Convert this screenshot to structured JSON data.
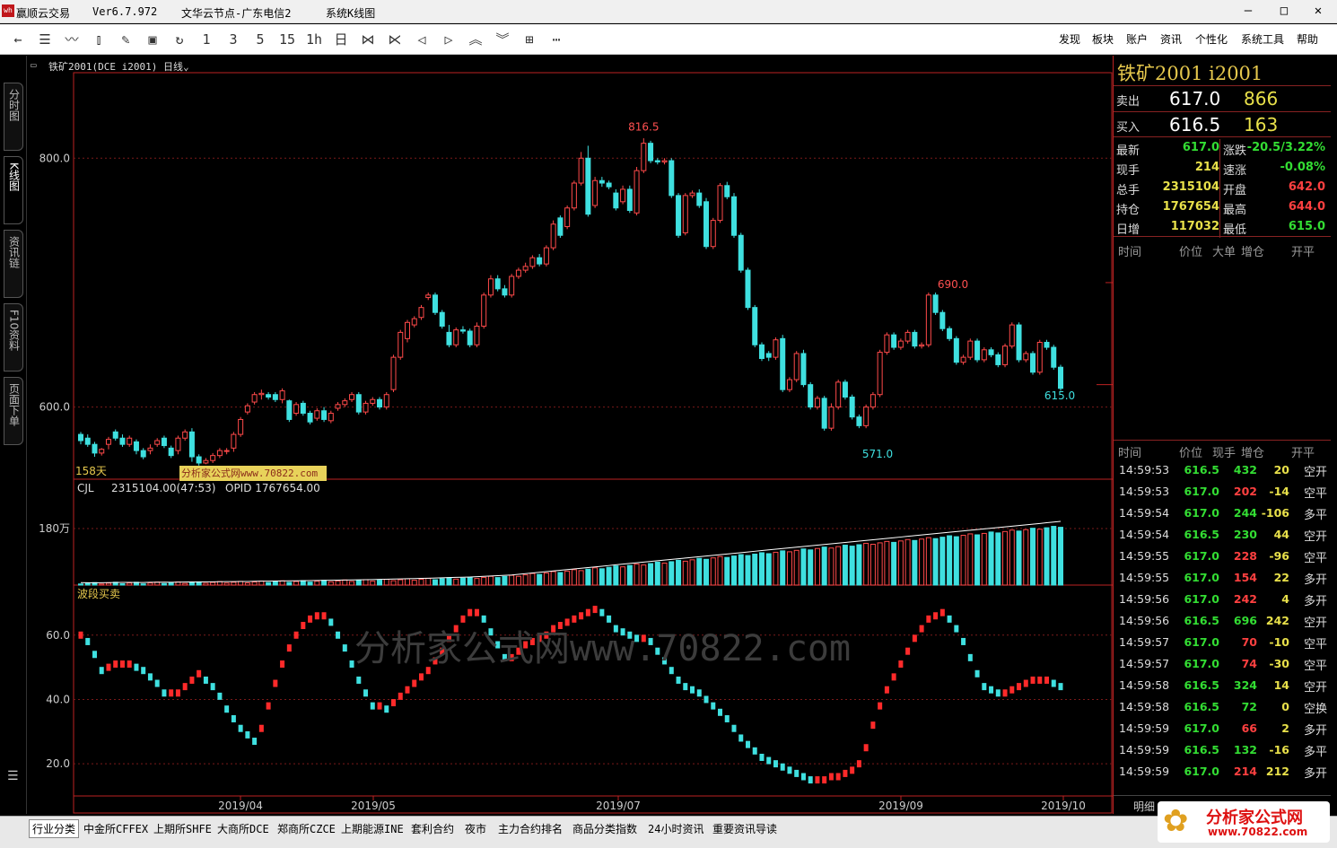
{
  "window": {
    "title": "赢顺云交易",
    "version": "Ver6.7.972",
    "node": "文华云节点-广东电信2",
    "chart_name": "系统K线图"
  },
  "toolbar": {
    "icons": [
      "back-icon",
      "list-icon",
      "line-chart-icon",
      "candle-icon",
      "draw-icon",
      "save-icon",
      "refresh-icon"
    ],
    "periods": [
      "1",
      "3",
      "5",
      "15",
      "1h",
      "日"
    ],
    "menu": [
      "发现",
      "板块",
      "账户",
      "资讯",
      "个性化",
      "系统工具",
      "帮助"
    ]
  },
  "side_tabs": [
    "分时图",
    "K线图",
    "资讯链",
    "F10资料",
    "页面下单"
  ],
  "chart_header": {
    "symbol": "铁矿2001(DCE i2001)",
    "period": "日线"
  },
  "main_chart": {
    "y_labels": [
      "800.0",
      "600.0"
    ],
    "days_label": "158天",
    "annotations": [
      "816.5",
      "690.0",
      "571.0",
      "615.0"
    ]
  },
  "volume_panel": {
    "name": "CJL",
    "cjl": "2315104.00(47:53)",
    "opid": "OPID 1767654.00",
    "y_label": "180万"
  },
  "wave_panel": {
    "name": "波段买卖",
    "y_labels": [
      "60.0",
      "40.0",
      "20.0"
    ]
  },
  "x_labels": [
    "2019/04",
    "2019/05",
    "2019/07",
    "2019/09",
    "2019/10"
  ],
  "watermark": "分析家公式网www.70822.com",
  "watermark_label": "分析家公式网www.70822.com",
  "quote": {
    "title": "铁矿2001  i2001",
    "sell": {
      "label": "卖出",
      "price": "617.0",
      "vol": "866"
    },
    "buy": {
      "label": "买入",
      "price": "616.5",
      "vol": "163"
    },
    "stats": [
      {
        "l1": "最新",
        "v1": "617.0",
        "l2": "涨跌",
        "v2": "-20.5/3.22%"
      },
      {
        "l1": "现手",
        "v1": "214",
        "l2": "速涨",
        "v2": "-0.08%"
      },
      {
        "l1": "总手",
        "v1": "2315104",
        "l2": "开盘",
        "v2": "642.0"
      },
      {
        "l1": "持仓",
        "v1": "1767654",
        "l2": "最高",
        "v2": "644.0"
      },
      {
        "l1": "日增",
        "v1": "117032",
        "l2": "最低",
        "v2": "615.0"
      }
    ],
    "header1": [
      "时间",
      "价位",
      "大单",
      "增仓",
      "开平"
    ],
    "header2": [
      "时间",
      "价位",
      "现手",
      "增仓",
      "开平"
    ],
    "ticks": [
      [
        "14:59:53",
        "616.5",
        "432",
        "20",
        "空开"
      ],
      [
        "14:59:53",
        "617.0",
        "202",
        "-14",
        "空平"
      ],
      [
        "14:59:54",
        "617.0",
        "244",
        "-106",
        "多平"
      ],
      [
        "14:59:54",
        "616.5",
        "230",
        "44",
        "空开"
      ],
      [
        "14:59:55",
        "617.0",
        "228",
        "-96",
        "空平"
      ],
      [
        "14:59:55",
        "617.0",
        "154",
        "22",
        "多开"
      ],
      [
        "14:59:56",
        "617.0",
        "242",
        "4",
        "多开"
      ],
      [
        "14:59:56",
        "616.5",
        "696",
        "242",
        "空开"
      ],
      [
        "14:59:57",
        "617.0",
        "70",
        "-10",
        "空平"
      ],
      [
        "14:59:57",
        "617.0",
        "74",
        "-30",
        "空平"
      ],
      [
        "14:59:58",
        "616.5",
        "324",
        "14",
        "空开"
      ],
      [
        "14:59:58",
        "616.5",
        "72",
        "0",
        "空换"
      ],
      [
        "14:59:59",
        "617.0",
        "66",
        "2",
        "多开"
      ],
      [
        "14:59:59",
        "616.5",
        "132",
        "-16",
        "多平"
      ],
      [
        "14:59:59",
        "617.0",
        "214",
        "212",
        "多开"
      ]
    ],
    "detail_label": "明细"
  },
  "bottom_tabs": [
    "行业分类",
    "中金所CFFEX",
    "上期所SHFE",
    "大商所DCE",
    "郑商所CZCE",
    "上期能源INE",
    "套利合约",
    "夜市",
    "主力合约排名",
    "商品分类指数",
    "24小时资讯",
    "重要资讯导读"
  ],
  "brand": {
    "name": "分析家公式网",
    "url": "www.70822.com"
  },
  "chart_data": {
    "type": "candlestick",
    "x_labels": [
      "2019/04",
      "2019/05",
      "2019/07",
      "2019/09",
      "2019/10"
    ],
    "ylim": [
      542,
      868
    ],
    "close": [
      573,
      570,
      563,
      566,
      574,
      575,
      570,
      575,
      565,
      560,
      567,
      573,
      569,
      561,
      575,
      580,
      560,
      555,
      557,
      561,
      565,
      565,
      578,
      590,
      601,
      610,
      611,
      608,
      606,
      613,
      590,
      602,
      595,
      588,
      597,
      590,
      595,
      602,
      605,
      610,
      596,
      603,
      606,
      600,
      610,
      640,
      660,
      668,
      671,
      680,
      690,
      676,
      665,
      650,
      662,
      661,
      650,
      665,
      690,
      703,
      695,
      690,
      705,
      710,
      713,
      720,
      715,
      728,
      747,
      738,
      760,
      780,
      800,
      755,
      782,
      780,
      777,
      760,
      775,
      758,
      790,
      812,
      798,
      797,
      798,
      770,
      738,
      770,
      772,
      762,
      729,
      750,
      778,
      769,
      738,
      710,
      680,
      650,
      639,
      640,
      654,
      614,
      622,
      643,
      618,
      600,
      607,
      583,
      600,
      620,
      608,
      592,
      585,
      600,
      610,
      644,
      658,
      648,
      653,
      660,
      649,
      650,
      690,
      676,
      663,
      655,
      636,
      640,
      653,
      638,
      646,
      642,
      634,
      649,
      666,
      638,
      643,
      628,
      652,
      648,
      632,
      615
    ],
    "open": [
      578,
      575,
      570,
      563,
      570,
      580,
      575,
      570,
      572,
      565,
      565,
      570,
      575,
      567,
      565,
      575,
      580,
      560,
      555,
      557,
      561,
      565,
      567,
      578,
      596,
      604,
      610,
      610,
      610,
      606,
      605,
      595,
      603,
      595,
      591,
      597,
      589,
      599,
      602,
      606,
      610,
      596,
      603,
      606,
      600,
      614,
      640,
      655,
      666,
      672,
      688,
      690,
      676,
      660,
      650,
      662,
      661,
      650,
      665,
      690,
      703,
      695,
      690,
      705,
      710,
      713,
      720,
      715,
      728,
      752,
      745,
      760,
      780,
      800,
      762,
      782,
      780,
      772,
      765,
      775,
      756,
      790,
      812,
      798,
      797,
      798,
      770,
      740,
      770,
      772,
      765,
      729,
      750,
      778,
      769,
      738,
      710,
      680,
      650,
      643,
      640,
      655,
      614,
      622,
      643,
      618,
      600,
      607,
      583,
      600,
      620,
      608,
      592,
      585,
      600,
      610,
      644,
      658,
      648,
      653,
      660,
      649,
      650,
      690,
      676,
      663,
      655,
      636,
      640,
      653,
      638,
      646,
      642,
      634,
      649,
      666,
      638,
      643,
      628,
      652,
      648,
      632
    ],
    "high": [
      580,
      578,
      572,
      567,
      576,
      582,
      578,
      577,
      574,
      567,
      570,
      575,
      577,
      569,
      577,
      582,
      583,
      562,
      559,
      563,
      567,
      567,
      580,
      592,
      603,
      612,
      614,
      612,
      612,
      615,
      606,
      604,
      605,
      597,
      599,
      600,
      597,
      604,
      607,
      612,
      612,
      605,
      608,
      608,
      612,
      642,
      662,
      670,
      673,
      682,
      692,
      692,
      678,
      666,
      664,
      665,
      663,
      668,
      692,
      706,
      706,
      698,
      707,
      712,
      716,
      722,
      723,
      730,
      750,
      754,
      762,
      782,
      805,
      810,
      785,
      785,
      782,
      775,
      778,
      778,
      793,
      816,
      814,
      800,
      800,
      800,
      772,
      772,
      774,
      775,
      768,
      752,
      780,
      781,
      772,
      740,
      712,
      682,
      652,
      645,
      656,
      658,
      624,
      645,
      646,
      620,
      609,
      609,
      603,
      622,
      622,
      610,
      594,
      602,
      612,
      646,
      660,
      660,
      655,
      662,
      662,
      652,
      692,
      692,
      678,
      665,
      657,
      642,
      655,
      655,
      648,
      648,
      644,
      651,
      668,
      668,
      645,
      645,
      654,
      654,
      650,
      634
    ],
    "low": [
      570,
      568,
      560,
      561,
      566,
      573,
      568,
      568,
      562,
      558,
      562,
      568,
      567,
      559,
      562,
      573,
      556,
      553,
      554,
      555,
      559,
      562,
      564,
      576,
      594,
      602,
      606,
      606,
      604,
      603,
      588,
      593,
      593,
      586,
      589,
      588,
      587,
      597,
      600,
      604,
      594,
      594,
      601,
      598,
      598,
      612,
      638,
      652,
      664,
      670,
      686,
      674,
      663,
      648,
      648,
      659,
      648,
      648,
      663,
      688,
      693,
      688,
      688,
      703,
      708,
      711,
      713,
      713,
      726,
      736,
      743,
      758,
      778,
      753,
      760,
      777,
      775,
      758,
      763,
      756,
      754,
      788,
      796,
      795,
      795,
      768,
      736,
      738,
      768,
      760,
      727,
      727,
      748,
      767,
      736,
      708,
      678,
      648,
      637,
      637,
      638,
      612,
      612,
      620,
      616,
      598,
      598,
      581,
      581,
      598,
      606,
      590,
      583,
      583,
      598,
      608,
      642,
      646,
      646,
      651,
      647,
      647,
      648,
      674,
      661,
      653,
      634,
      634,
      638,
      636,
      636,
      640,
      632,
      632,
      647,
      636,
      636,
      626,
      626,
      646,
      630,
      613
    ],
    "volume_max": 3200000,
    "volumes": [
      35,
      32,
      30,
      34,
      36,
      40,
      42,
      41,
      40,
      38,
      44,
      46,
      48,
      45,
      50,
      52,
      55,
      53,
      58,
      60,
      62,
      64,
      66,
      68,
      70,
      74,
      78,
      80,
      82,
      85,
      88,
      90,
      92,
      95,
      98,
      102,
      105,
      108,
      112,
      115,
      118,
      122,
      125,
      130,
      135,
      140,
      145,
      150,
      155,
      160,
      165,
      170,
      178,
      185,
      190,
      195,
      200,
      210,
      220,
      230,
      240,
      250,
      260,
      280,
      300,
      320,
      340,
      360,
      380,
      400,
      420,
      440,
      460,
      480,
      500,
      520,
      540,
      560,
      580,
      600,
      620,
      640,
      660,
      680,
      700,
      720,
      740,
      760,
      780,
      800,
      820,
      840,
      860,
      880,
      900,
      920,
      940,
      960,
      980,
      1000,
      1020,
      1040,
      1060,
      1080,
      1100,
      1120,
      1140,
      1160,
      1180,
      1200,
      1220,
      1240,
      1260,
      1280,
      1300,
      1320,
      1340,
      1360,
      1380,
      1400,
      1420,
      1440,
      1460,
      1480,
      1500,
      1520,
      1540,
      1560,
      1580,
      1600,
      1620,
      1640,
      1660,
      1680,
      1700,
      1720,
      1740,
      1760,
      1780,
      1800,
      1820,
      1840
    ],
    "wave": [
      60,
      58,
      54,
      49,
      50,
      51,
      51,
      51,
      50,
      49,
      47,
      45,
      42,
      42,
      42,
      44,
      46,
      48,
      46,
      44,
      41,
      37,
      34,
      31,
      29,
      27,
      31,
      38,
      45,
      51,
      56,
      60,
      63,
      65,
      66,
      66,
      64,
      60,
      56,
      51,
      46,
      42,
      38,
      38,
      37,
      39,
      41,
      43,
      45,
      47,
      49,
      52,
      55,
      59,
      62,
      65,
      67,
      67,
      65,
      61,
      57,
      53,
      53,
      55,
      57,
      58,
      59,
      60,
      62,
      63,
      64,
      65,
      66,
      67,
      68,
      67,
      65,
      62,
      61,
      60,
      59,
      59,
      58,
      55,
      52,
      49,
      46,
      44,
      43,
      42,
      40,
      38,
      36,
      34,
      31,
      28,
      26,
      24,
      22,
      21,
      20,
      19,
      18,
      17,
      16,
      15,
      15,
      15,
      16,
      16,
      17,
      18,
      20,
      25,
      32,
      38,
      43,
      47,
      51,
      55,
      59,
      62,
      65,
      66,
      67,
      65,
      62,
      58,
      53,
      48,
      44,
      43,
      42,
      42,
      43,
      44,
      45,
      46,
      46,
      46,
      45,
      44,
      43
    ]
  }
}
